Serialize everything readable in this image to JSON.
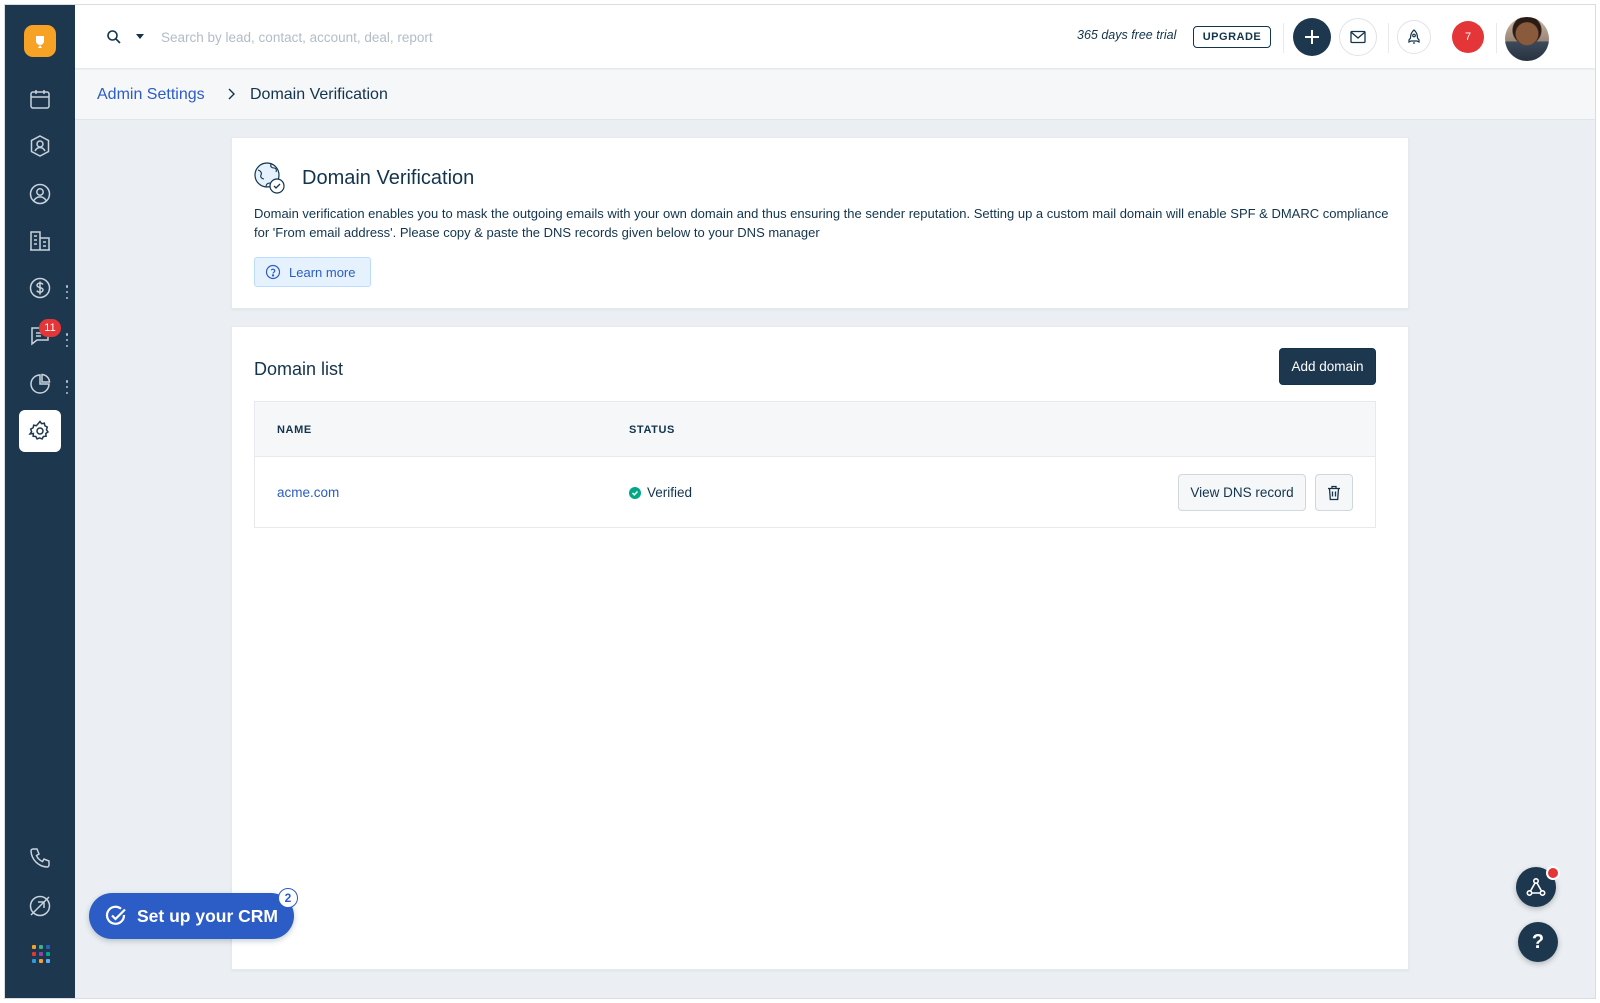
{
  "topbar": {
    "search_placeholder": "Search by lead, contact, account, deal, report",
    "trial_text": "365 days free trial",
    "upgrade_label": "UPGRADE",
    "notification_count": "7"
  },
  "sidebar": {
    "items": [
      {
        "name": "calendar-icon"
      },
      {
        "name": "contacts-icon"
      },
      {
        "name": "user-icon"
      },
      {
        "name": "accounts-icon"
      },
      {
        "name": "deals-icon"
      },
      {
        "name": "conversations-icon"
      },
      {
        "name": "reports-icon"
      },
      {
        "name": "settings-icon",
        "active": true
      }
    ],
    "conversations_badge": "11",
    "bottom": [
      "phone-icon",
      "no-tracking-icon",
      "apps-grid-icon"
    ]
  },
  "breadcrumb": {
    "parent": "Admin Settings",
    "current": "Domain Verification"
  },
  "info_card": {
    "title": "Domain Verification",
    "description": "Domain verification enables you to mask the outgoing emails with your own domain and thus ensuring the sender reputation. Setting up a custom mail domain will enable SPF & DMARC compliance for 'From email address'. Please copy & paste the DNS records given below to your DNS manager",
    "learn_more": "Learn more"
  },
  "domain_list": {
    "title": "Domain list",
    "add_button": "Add domain",
    "columns": [
      "NAME",
      "STATUS"
    ],
    "rows": [
      {
        "name": "acme.com",
        "status": "Verified",
        "view_button": "View DNS record"
      }
    ]
  },
  "setup_crm": {
    "label": "Set up your CRM",
    "badge": "2"
  },
  "help": {
    "label": "?"
  },
  "colors": {
    "sidebar": "#1d374f",
    "link": "#2c5cc5",
    "verified": "#00a886",
    "alert": "#e43538",
    "brand": "#f7a125"
  }
}
